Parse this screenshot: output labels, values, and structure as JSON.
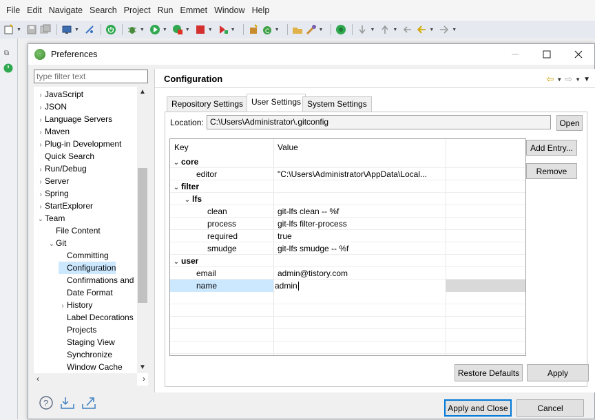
{
  "menubar": [
    "File",
    "Edit",
    "Navigate",
    "Search",
    "Project",
    "Run",
    "Emmet",
    "Window",
    "Help"
  ],
  "dialog": {
    "title": "Preferences",
    "filter_placeholder": "type filter text"
  },
  "tree": [
    {
      "label": "JavaScript",
      "arrow": ">",
      "indent": 0
    },
    {
      "label": "JSON",
      "arrow": ">",
      "indent": 0
    },
    {
      "label": "Language Servers",
      "arrow": ">",
      "indent": 0
    },
    {
      "label": "Maven",
      "arrow": ">",
      "indent": 0
    },
    {
      "label": "Plug-in Development",
      "arrow": ">",
      "indent": 0
    },
    {
      "label": "Quick Search",
      "arrow": "",
      "indent": 0
    },
    {
      "label": "Run/Debug",
      "arrow": ">",
      "indent": 0
    },
    {
      "label": "Server",
      "arrow": ">",
      "indent": 0
    },
    {
      "label": "Spring",
      "arrow": ">",
      "indent": 0
    },
    {
      "label": "StartExplorer",
      "arrow": ">",
      "indent": 0
    },
    {
      "label": "Team",
      "arrow": "v",
      "indent": 0
    },
    {
      "label": "File Content",
      "arrow": "",
      "indent": 1
    },
    {
      "label": "Git",
      "arrow": "v",
      "indent": 1
    },
    {
      "label": "Committing",
      "arrow": "",
      "indent": 2
    },
    {
      "label": "Configuration",
      "arrow": "",
      "indent": 2,
      "selected": true
    },
    {
      "label": "Confirmations and",
      "arrow": "",
      "indent": 2
    },
    {
      "label": "Date Format",
      "arrow": "",
      "indent": 2
    },
    {
      "label": "History",
      "arrow": ">",
      "indent": 2
    },
    {
      "label": "Label Decorations",
      "arrow": "",
      "indent": 2
    },
    {
      "label": "Projects",
      "arrow": "",
      "indent": 2
    },
    {
      "label": "Staging View",
      "arrow": "",
      "indent": 2
    },
    {
      "label": "Synchronize",
      "arrow": "",
      "indent": 2
    },
    {
      "label": "Window Cache",
      "arrow": "",
      "indent": 2
    }
  ],
  "page": {
    "title": "Configuration",
    "tabs": [
      "Repository Settings",
      "User Settings",
      "System Settings"
    ],
    "location_label": "Location:",
    "location_value": "C:\\Users\\Administrator\\.gitconfig",
    "open_button": "Open",
    "add_entry_button": "Add Entry...",
    "remove_button": "Remove",
    "restore_defaults_button": "Restore Defaults",
    "apply_button": "Apply"
  },
  "table": {
    "headers": [
      "Key",
      "Value"
    ],
    "rows": [
      {
        "key": "core",
        "value": "",
        "level": 0,
        "group": true
      },
      {
        "key": "editor",
        "value": "\"C:\\Users\\Administrator\\AppData\\Local...",
        "level": 1
      },
      {
        "key": "filter",
        "value": "",
        "level": 0,
        "group": true
      },
      {
        "key": "lfs",
        "value": "",
        "level": 1,
        "group": true
      },
      {
        "key": "clean",
        "value": "git-lfs clean -- %f",
        "level": 2
      },
      {
        "key": "process",
        "value": "git-lfs filter-process",
        "level": 2
      },
      {
        "key": "required",
        "value": "true",
        "level": 2
      },
      {
        "key": "smudge",
        "value": "git-lfs smudge -- %f",
        "level": 2
      },
      {
        "key": "user",
        "value": "",
        "level": 0,
        "group": true
      },
      {
        "key": "email",
        "value": "admin@tistory.com",
        "level": 1
      },
      {
        "key": "name",
        "value": "admin",
        "level": 1,
        "editing": true
      }
    ]
  },
  "footer": {
    "apply_close_button": "Apply and Close",
    "cancel_button": "Cancel"
  }
}
